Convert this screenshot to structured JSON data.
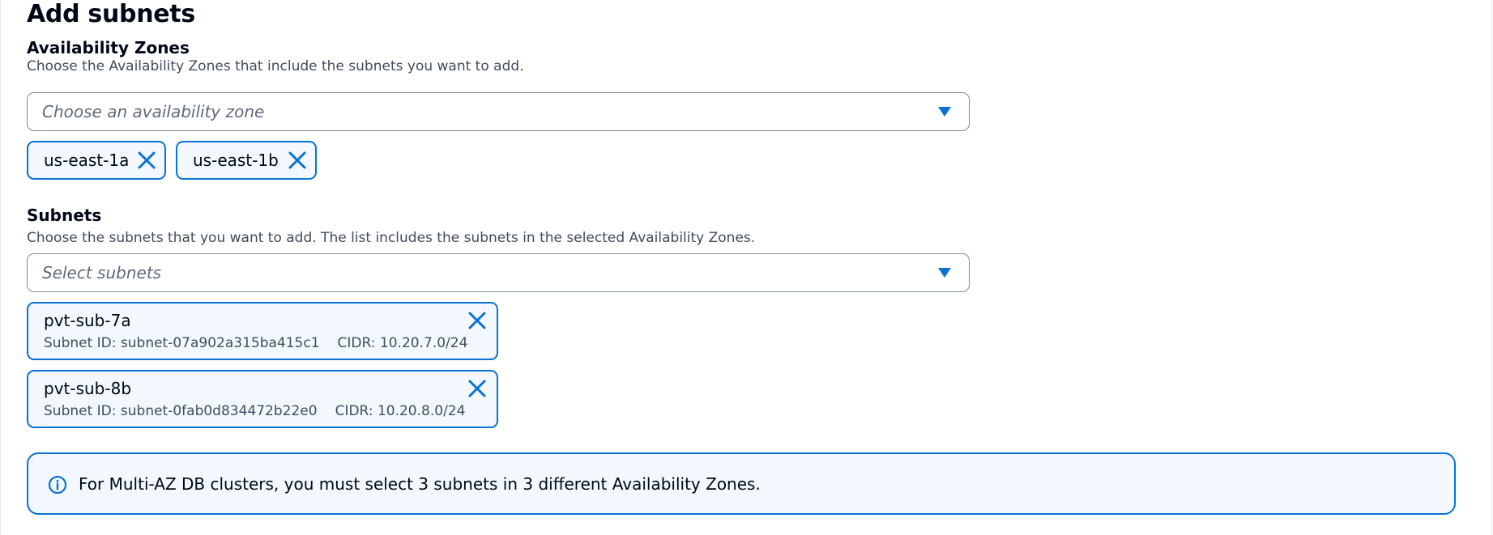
{
  "page": {
    "title": "Add subnets"
  },
  "availability_zones": {
    "label": "Availability Zones",
    "description": "Choose the Availability Zones that include the subnets you want to add.",
    "placeholder": "Choose an availability zone",
    "selected": [
      {
        "label": "us-east-1a"
      },
      {
        "label": "us-east-1b"
      }
    ]
  },
  "subnets": {
    "label": "Subnets",
    "description": "Choose the subnets that you want to add. The list includes the subnets in the selected Availability Zones.",
    "placeholder": "Select subnets",
    "selected": [
      {
        "name": "pvt-sub-7a",
        "subnet_id": "Subnet ID: subnet-07a902a315ba415c1",
        "cidr": "CIDR: 10.20.7.0/24"
      },
      {
        "name": "pvt-sub-8b",
        "subnet_id": "Subnet ID: subnet-0fab0d834472b22e0",
        "cidr": "CIDR: 10.20.8.0/24"
      }
    ]
  },
  "alert": {
    "icon": "info-icon",
    "text": "For Multi-AZ DB clusters, you must select 3 subnets in 3 different Availability Zones."
  },
  "colors": {
    "accent": "#0972d3",
    "token_background": "#f2f8fd",
    "text": "#000716",
    "secondary_text": "#414d5c"
  }
}
